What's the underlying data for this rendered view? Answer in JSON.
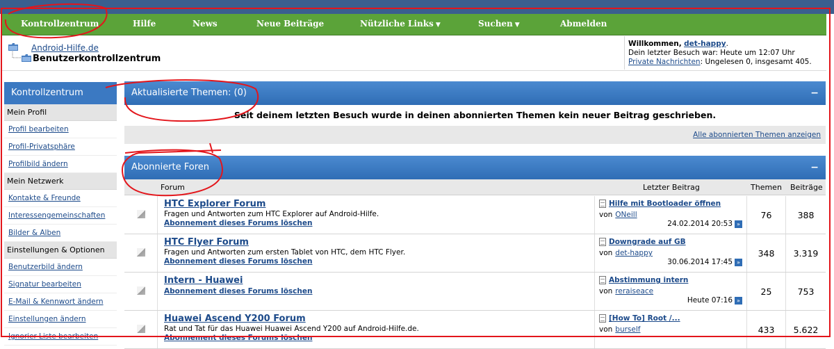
{
  "nav": {
    "items": [
      {
        "label": "Kontrollzentrum",
        "dropdown": false
      },
      {
        "label": "Hilfe",
        "dropdown": false
      },
      {
        "label": "News",
        "dropdown": false
      },
      {
        "label": "Neue Beiträge",
        "dropdown": false
      },
      {
        "label": "Nützliche Links",
        "dropdown": true
      },
      {
        "label": "Suchen",
        "dropdown": true
      },
      {
        "label": "Abmelden",
        "dropdown": false
      }
    ],
    "caret": "▼"
  },
  "breadcrumb": {
    "home": "Android-Hilfe.de",
    "current": "Benutzerkontrollzentrum"
  },
  "welcome": {
    "greeting": "Willkommen,",
    "username": "det-happy",
    "period": ".",
    "last_visit": "Dein letzter Besuch war: Heute um 12:07 Uhr",
    "pm_link": "Private Nachrichten",
    "pm_status": ": Ungelesen 0, insgesamt 405."
  },
  "sidebar": {
    "title": "Kontrollzentrum",
    "groups": [
      {
        "label": "Mein Profil",
        "links": [
          "Profil bearbeiten",
          "Profil-Privatsphäre",
          "Profilbild ändern"
        ]
      },
      {
        "label": "Mein Netzwerk",
        "links": [
          "Kontakte & Freunde",
          "Interessengemeinschaften",
          "Bilder & Alben"
        ]
      },
      {
        "label": "Einstellungen & Optionen",
        "links": [
          "Benutzerbild ändern",
          "Signatur bearbeiten",
          "E-Mail & Kennwort ändern",
          "Einstellungen ändern",
          "Ignorier-Liste bearbeiten"
        ]
      }
    ]
  },
  "updated": {
    "title": "Aktualisierte Themen: (0)",
    "collapse": "−",
    "message": "Seit deinem letzten Besuch wurde in deinen abonnierten Themen kein neuer Beitrag geschrieben.",
    "all_link": "Alle abonnierten Themen anzeigen"
  },
  "forums": {
    "title": "Abonnierte Foren",
    "collapse": "−",
    "columns": {
      "forum": "Forum",
      "last_post": "Letzter Beitrag",
      "threads": "Themen",
      "posts": "Beiträge"
    },
    "by_label": "von",
    "goto_glyph": "»",
    "rows": [
      {
        "title": "HTC Explorer Forum",
        "description": "Fragen und Antworten zum HTC Explorer auf Android-Hilfe.",
        "unsubscribe": "Abonnement dieses Forums löschen",
        "last_title": "Hilfe mit Bootloader öffnen",
        "last_user": "ONeill",
        "last_date": "24.02.2014 20:53",
        "threads": "76",
        "posts": "388"
      },
      {
        "title": "HTC Flyer Forum",
        "description": "Fragen und Antworten zum ersten Tablet von HTC, dem HTC Flyer.",
        "unsubscribe": "Abonnement dieses Forums löschen",
        "last_title": "Downgrade auf GB",
        "last_user": "det-happy",
        "last_date": "30.06.2014 17:45",
        "threads": "348",
        "posts": "3.319"
      },
      {
        "title": "Intern - Huawei",
        "description": "",
        "unsubscribe": "Abonnement dieses Forums löschen",
        "last_title": "Abstimmung intern",
        "last_user": "reraiseace",
        "last_date": "Heute 07:16",
        "threads": "25",
        "posts": "753"
      },
      {
        "title": "Huawei Ascend Y200 Forum",
        "description": "Rat und Tat für das Huawei Huawei Ascend Y200 auf Android-Hilfe.de.",
        "unsubscribe": "Abonnement dieses Forums löschen",
        "last_title": "[How To] Root /...",
        "last_user": "burself",
        "last_date": "",
        "threads": "433",
        "posts": "5.622"
      }
    ]
  },
  "colors": {
    "nav": "#5ba339",
    "panel": "#3b79c2",
    "link": "#1c4a8a",
    "annotation": "#e3151b"
  }
}
